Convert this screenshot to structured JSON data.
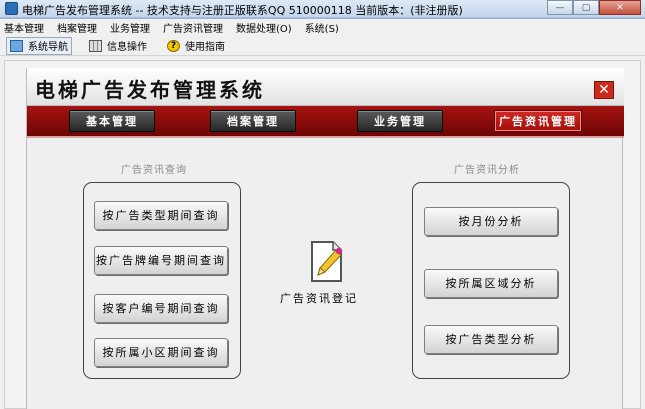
{
  "window": {
    "title": "电梯广告发布管理系统 -- 技术支持与注册正版联系QQ 510000118    当前版本：(非注册版)",
    "minimize": "—",
    "maximize": "▢",
    "close": "✕"
  },
  "menu": [
    "基本管理",
    "档案管理",
    "业务管理",
    "广告资讯管理",
    "数据处理(O)",
    "系统(S)"
  ],
  "toolbar": [
    {
      "label": "系统导航",
      "icon": "monitor-icon"
    },
    {
      "label": "信息操作",
      "icon": "grid-icon"
    },
    {
      "label": "使用指南",
      "icon": "help-icon"
    }
  ],
  "app": {
    "title": "电梯广告发布管理系统",
    "close": "✕",
    "nav": [
      "基本管理",
      "档案管理",
      "业务管理",
      "广告资讯管理"
    ],
    "active_nav": "广告资讯管理"
  },
  "query": {
    "title": "广告资讯查询",
    "buttons": [
      "按广告类型期间查询",
      "按广告牌编号期间查询",
      "按客户编号期间查询",
      "按所属小区期间查询"
    ]
  },
  "center": {
    "label": "广告资讯登记",
    "icon": "edit-document-icon"
  },
  "analysis": {
    "title": "广告资讯分析",
    "buttons": [
      "按月份分析",
      "按所属区域分析",
      "按广告类型分析"
    ]
  },
  "colors": {
    "nav_red": "#a51410",
    "active_red": "#d32a24",
    "title_bar": "#c3d5ec"
  }
}
